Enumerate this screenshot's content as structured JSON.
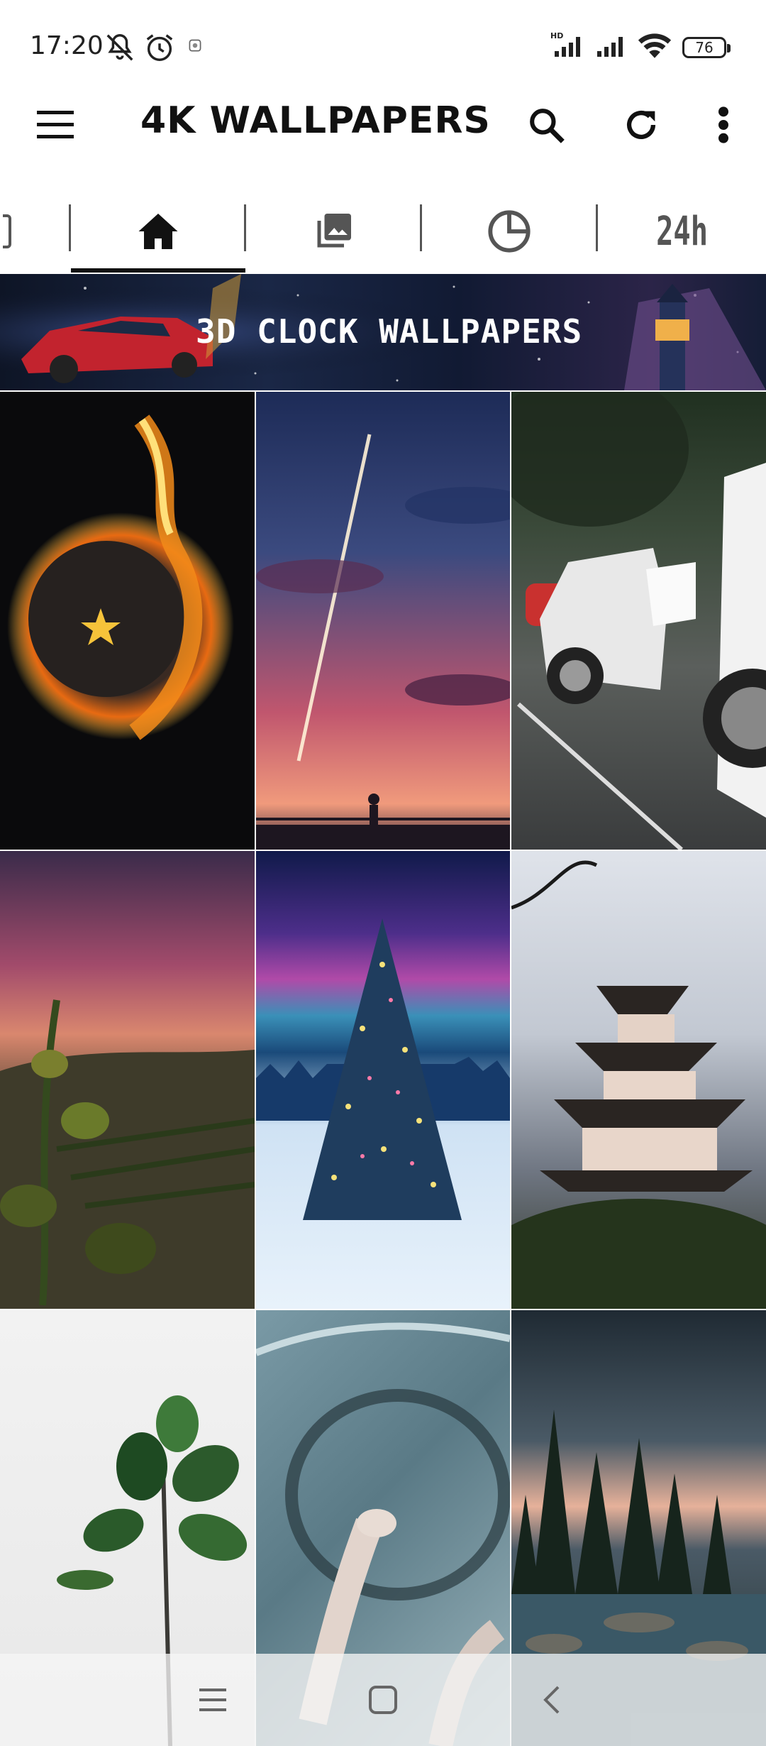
{
  "status_bar": {
    "time": "17:20",
    "battery": "76",
    "icons": [
      "mute-icon",
      "alarm-icon",
      "notification-icon",
      "hd-signal-icon",
      "signal-icon",
      "wifi-icon",
      "battery-icon"
    ]
  },
  "app_bar": {
    "title": "4K WALLPAPERS",
    "icons": [
      "menu-icon",
      "search-icon",
      "refresh-icon",
      "more-vert-icon"
    ]
  },
  "tabs": [
    {
      "id": "partial",
      "label": ""
    },
    {
      "id": "home",
      "icon": "home-icon",
      "selected": true
    },
    {
      "id": "gallery",
      "icon": "gallery-icon"
    },
    {
      "id": "recent",
      "icon": "clock-icon"
    },
    {
      "id": "24h",
      "label": "24h"
    }
  ],
  "banner": {
    "text": "3D CLOCK WALLPAPERS"
  },
  "wallpapers": [
    {
      "subject": "fiery planet"
    },
    {
      "subject": "sunset sky with shooting star"
    },
    {
      "subject": "white sports car"
    },
    {
      "subject": "vineyard at sunset"
    },
    {
      "subject": "christmas tree with aurora"
    },
    {
      "subject": "japanese castle"
    },
    {
      "subject": "green plant"
    },
    {
      "subject": "driving hands"
    },
    {
      "subject": "forest lake"
    }
  ],
  "nav_bar": {
    "icons": [
      "recents-icon",
      "home-nav-icon",
      "back-icon"
    ]
  },
  "colors": {
    "accent": "#111111",
    "banner_bg": "#111a33"
  }
}
